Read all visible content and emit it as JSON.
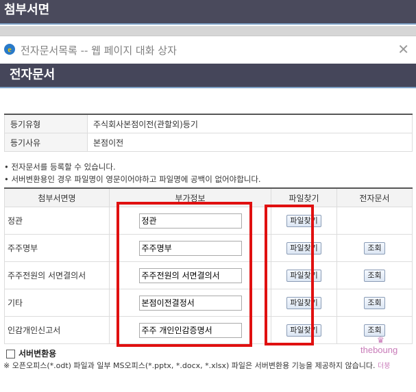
{
  "top_bar": {
    "title": "첨부서면"
  },
  "dialog": {
    "title": "전자문서목록 -- 웹 페이지 대화 상자",
    "close": "✕",
    "header": "전자문서"
  },
  "info": [
    {
      "label": "등기유형",
      "value": "주식회사본점이전(관할외)등기"
    },
    {
      "label": "등기사유",
      "value": "본점이전"
    }
  ],
  "notes": [
    "• 전자문서를 등록할 수 있습니다.",
    "• 서버변환용인 경우 파일명이 영문이어야하고 파일명에 공백이 없어야합니다."
  ],
  "table": {
    "columns": [
      "첨부서면명",
      "부가정보",
      "파일찾기",
      "전자문서"
    ],
    "rows": [
      {
        "name": "정관",
        "extra": "정관",
        "find": "파일찾기",
        "doc": ""
      },
      {
        "name": "주주명부",
        "extra": "주주명부",
        "find": "파일찾기",
        "doc": "조회"
      },
      {
        "name": "주주전원의 서면결의서",
        "extra": "주주전원의 서면결의서",
        "find": "파일찾기",
        "doc": "조회"
      },
      {
        "name": "기타",
        "extra": "본점이전결정서",
        "find": "파일찾기",
        "doc": "조회"
      },
      {
        "name": "인감개인신고서",
        "extra": "주주 개인인감증명서",
        "find": "파일찾기",
        "doc": "조회"
      }
    ]
  },
  "server_convert": {
    "label": "서버변환용"
  },
  "footnote": "※ 오픈오피스(*.odt) 파일과 일부 MS오피스(*.pptx, *.docx, *.xlsx) 파일은 서버변환용 기능을 제공하지 않습니다.",
  "watermark": {
    "brand": "theboung",
    "small": "더붕"
  },
  "colors": {
    "header_bg": "#45465a",
    "highlight": "#e01010",
    "accent": "#7ea3c8"
  }
}
